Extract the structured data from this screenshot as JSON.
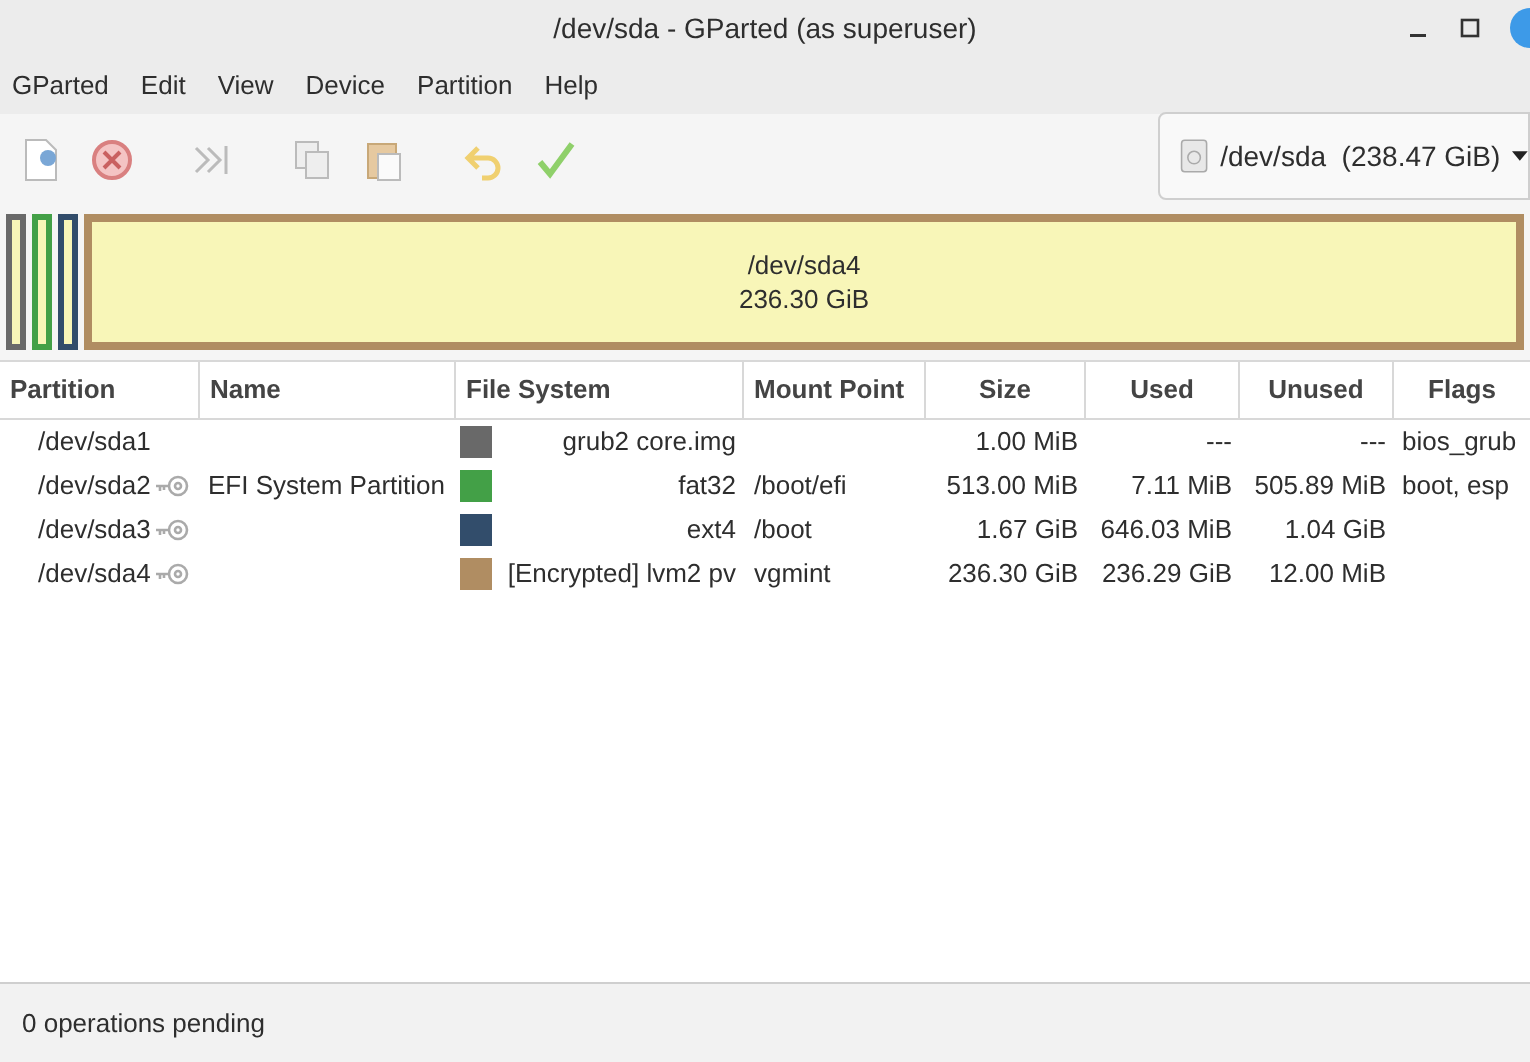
{
  "window": {
    "title": "/dev/sda - GParted (as superuser)"
  },
  "menu": [
    "GParted",
    "Edit",
    "View",
    "Device",
    "Partition",
    "Help"
  ],
  "device_selector": {
    "value": "/dev/sda  (238.47 GiB)"
  },
  "partition_map": [
    {
      "color": "#696969"
    },
    {
      "color": "#43a047"
    },
    {
      "color": "#324d6b"
    },
    {
      "color": "#b08d62",
      "label": "/dev/sda4",
      "size": "236.30 GiB"
    }
  ],
  "table": {
    "columns": [
      "Partition",
      "Name",
      "File System",
      "Mount Point",
      "Size",
      "Used",
      "Unused",
      "Flags"
    ],
    "rows": [
      {
        "partition": "/dev/sda1",
        "mounted": false,
        "color": "#696969",
        "file_system": "grub2 core.img",
        "size": "1.00 MiB",
        "used": "---",
        "unused": "---",
        "flags": "bios_grub"
      },
      {
        "partition": "/dev/sda2",
        "mounted": true,
        "name": "EFI System Partition",
        "color": "#43a047",
        "file_system": "fat32",
        "mount_point": "/boot/efi",
        "size": "513.00 MiB",
        "used": "7.11 MiB",
        "unused": "505.89 MiB",
        "flags": "boot, esp"
      },
      {
        "partition": "/dev/sda3",
        "mounted": true,
        "color": "#324d6b",
        "file_system": "ext4",
        "mount_point": "/boot",
        "size": "1.67 GiB",
        "used": "646.03 MiB",
        "unused": "1.04 GiB"
      },
      {
        "partition": "/dev/sda4",
        "mounted": true,
        "color": "#b08d62",
        "file_system": "[Encrypted] lvm2 pv",
        "mount_point": "vgmint",
        "size": "236.30 GiB",
        "used": "236.29 GiB",
        "unused": "12.00 MiB"
      }
    ]
  },
  "status_bar": "0 operations pending"
}
